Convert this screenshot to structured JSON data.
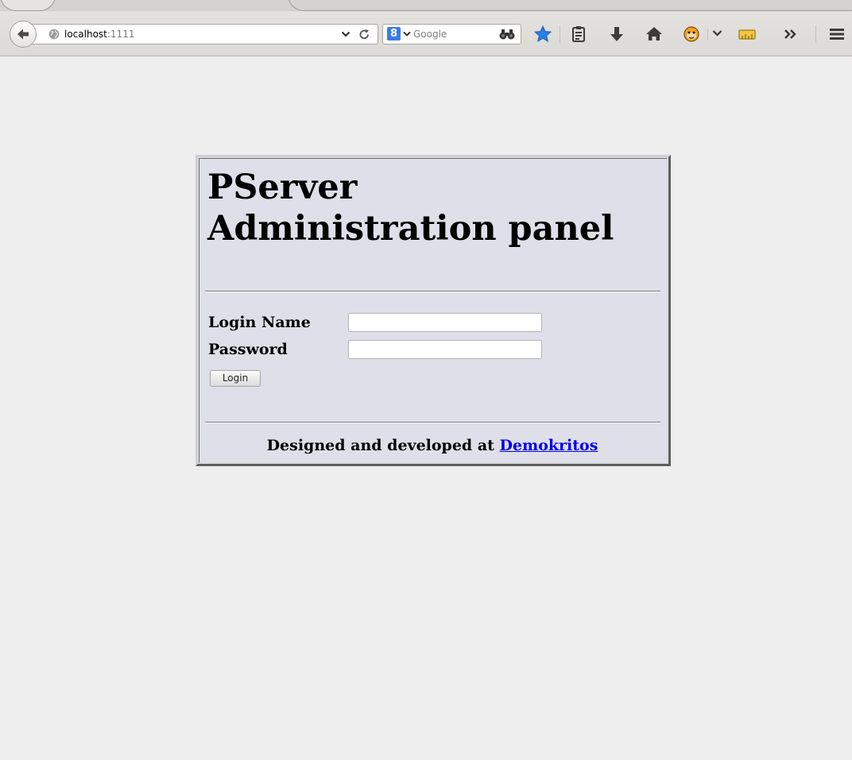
{
  "browser": {
    "url_host": "localhost",
    "url_port": ":1111",
    "search_placeholder": "Google",
    "search_engine_icon": "google-g-icon",
    "toolbar_icons": [
      "bookmark-star-icon",
      "reading-list-icon",
      "download-icon",
      "home-icon",
      "greasemonkey-icon",
      "chevron-down-icon",
      "ruler-icon",
      "overflow-icon",
      "menu-icon"
    ],
    "colors": {
      "chrome": "#e6e4e1",
      "star": "#2a7fe4",
      "monkey": "#f0a323",
      "link": "#0000ee"
    }
  },
  "page": {
    "title_line1": "PServer",
    "title_line2": "Administration panel",
    "login_label": "Login Name",
    "password_label": "Password",
    "login_value": "",
    "password_value": "",
    "login_button": "Login",
    "footer_prefix": "Designed and developed at ",
    "footer_link": "Demokritos"
  }
}
